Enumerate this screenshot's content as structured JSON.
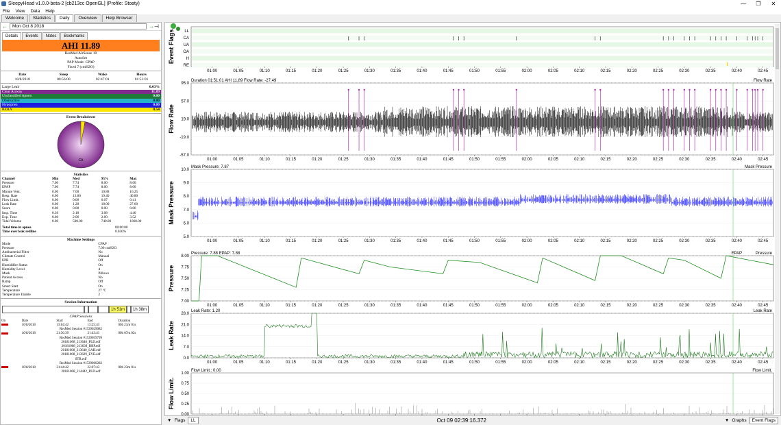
{
  "window": {
    "title": "SleepyHead v1.0.0-beta-2 [cb213cc OpenGL] (Profile: Stoaty)",
    "min": "—",
    "max": "❐",
    "close": "✕"
  },
  "menu": [
    "File",
    "View",
    "Data",
    "Help"
  ],
  "tabs": [
    "Welcome",
    "Statistics",
    "Daily",
    "Overview",
    "Help Browser"
  ],
  "date": "Mon Oct 8 2018",
  "subtabs": [
    "Details",
    "Events",
    "Notes",
    "Bookmarks"
  ],
  "ahi": "AHI 11.89",
  "device": {
    "model": "ResMed AirSense 10",
    "variant": "AutoSet",
    "mode": "PAP Mode: CPAP",
    "fixed": "Fixed 7 (cmH2O)"
  },
  "sleep": {
    "headers": [
      "Date",
      "Sleep",
      "Wake",
      "Hours"
    ],
    "values": [
      "10/8/2018",
      "00:56:00",
      "02:47:01",
      "01:51:01"
    ]
  },
  "events": [
    {
      "name": "Large Leak",
      "value": "0.03%",
      "color": "#ffffff",
      "fg": "#000"
    },
    {
      "name": "Clear Airway",
      "value": "11.89",
      "color": "#7f2a8c",
      "fg": "#fff"
    },
    {
      "name": "Unclassified Apnea",
      "value": "0.00",
      "color": "#1f7a3a",
      "fg": "#fff"
    },
    {
      "name": "Obstructive",
      "value": "0.00",
      "color": "#27b6c8",
      "fg": "#000"
    },
    {
      "name": "Hypopnea",
      "value": "0.00",
      "color": "#1a1ae0",
      "fg": "#fff"
    },
    {
      "name": "RERA",
      "value": "0.54",
      "color": "#ffe800",
      "fg": "#000"
    }
  ],
  "breakdown": {
    "title": "Event Breakdown",
    "label": "CA"
  },
  "statistics": {
    "title": "Statistics",
    "headers": [
      "Channel",
      "Min",
      "Med",
      "95%",
      "Max"
    ],
    "rows": [
      [
        "Pressure",
        "7.00",
        "7.74",
        "8.00",
        "8.00"
      ],
      [
        "EPAP",
        "7.00",
        "7.74",
        "8.00",
        "8.00"
      ],
      [
        "Minute Vent.",
        "0.00",
        "7.00",
        "10.88",
        "16.25"
      ],
      [
        "Resp. Rate",
        "0.00",
        "13.80",
        "19.40",
        "40.80"
      ],
      [
        "Flow Limit.",
        "0.00",
        "0.00",
        "0.07",
        "0.41"
      ],
      [
        "Leak Rate",
        "0.00",
        "1.20",
        "18.00",
        "27.60"
      ],
      [
        "Snore",
        "0.00",
        "0.00",
        "0.00",
        "0.06"
      ],
      [
        "Insp. Time",
        "0.36",
        "2.18",
        "3.08",
        "4.40"
      ],
      [
        "Exp. Time",
        "0.06",
        "2.06",
        "2.60",
        "3.52"
      ],
      [
        "Tidal Volume",
        "0.00",
        "500.00",
        "740.00",
        "1060.00"
      ]
    ]
  },
  "apnea": {
    "label1": "Total time in apnea",
    "value1": "00:06:00",
    "label2": "Time over leak redline",
    "value2": "0.030%"
  },
  "machine": {
    "title": "Machine Settings",
    "rows": [
      [
        "Mode",
        "CPAP"
      ],
      [
        "Pressure",
        "7.00 cmH2O"
      ],
      [
        "Antibacterial Filter",
        "No"
      ],
      [
        "Climate Control",
        "Manual"
      ],
      [
        "EPR",
        "Off"
      ],
      [
        "Humidifier Status",
        "On"
      ],
      [
        "Humidity Level",
        "4"
      ],
      [
        "Mask",
        "Pillows"
      ],
      [
        "Patient Access",
        "No"
      ],
      [
        "Ramp",
        "Off"
      ],
      [
        "Smart Start",
        "On"
      ],
      [
        "Temperature",
        "27 ºC"
      ],
      [
        "Temperature Enable",
        "2"
      ]
    ]
  },
  "session_info": {
    "title": "Session Information",
    "seg1": "1h 51m",
    "seg2": "1h 38m"
  },
  "cpap_sessions": {
    "title": "CPAP Sessions",
    "headers": [
      "On",
      "Date",
      "Start",
      "End",
      "Duration"
    ],
    "rows": [
      {
        "type": "row",
        "date": "10/8/2018",
        "start": "13:04:42",
        "end": "13:25:43",
        "dur": "00h 21m 01s"
      },
      {
        "type": "file",
        "text": "ResMed Session #1539029082"
      },
      {
        "type": "row",
        "date": "10/8/2018",
        "start": "21:36:39",
        "end": "21:43:41",
        "dur": "00h 07m 02s"
      },
      {
        "type": "file",
        "text": "ResMed Session #1539059799"
      },
      {
        "type": "file",
        "text": "20181008_213640_PLD.edf"
      },
      {
        "type": "file",
        "text": "20181008_213639_BRP.edf"
      },
      {
        "type": "file",
        "text": "20181008_213640_SAD.edf"
      },
      {
        "type": "file",
        "text": "20181008_213629_EVE.edf"
      },
      {
        "type": "file",
        "text": "STR.edf"
      },
      {
        "type": "file",
        "text": "ResMed Session #1539060282"
      },
      {
        "type": "row",
        "date": "10/8/2018",
        "start": "21:44:42",
        "end": "22:07:43",
        "dur": "00h 23m 01s"
      },
      {
        "type": "file",
        "text": "20181008_214442_PLD.edf"
      }
    ]
  },
  "time_ticks": [
    "01:00",
    "01:05",
    "01:10",
    "01:15",
    "01:20",
    "01:25",
    "01:30",
    "01:35",
    "01:40",
    "01:45",
    "01:50",
    "01:55",
    "02:00",
    "02:05",
    "02:10",
    "02:15",
    "02:20",
    "02:25",
    "02:30",
    "02:35",
    "02:40",
    "02:45"
  ],
  "graphs": [
    {
      "name": "Event Flags",
      "ylabels": [
        "LL",
        "CA",
        "UA",
        "OA",
        "H",
        "RE"
      ]
    },
    {
      "name": "Flow Rate",
      "header": "Duration 01:51:01 AHI 11.89 Flow Rate: -27.49",
      "legend": "Flow Rate",
      "ylabels": [
        "95.0",
        "57.0",
        "19.0",
        "-19.0",
        "-57.0"
      ]
    },
    {
      "name": "Mask Pressure",
      "header": "Mask Pressure: 7.87",
      "legend": "Mask Pressure",
      "ylabels": [
        "10.0",
        "9.0",
        "8.0",
        "7.0",
        "6.0",
        "5.0"
      ]
    },
    {
      "name": "Pressure",
      "header": "Pressure: 7.88 EPAP: 7.88",
      "legend": "EPAP",
      "legend2": "Pressure",
      "ylabels": [
        "8.00",
        "7.75",
        "7.50",
        "7.25",
        "7.00"
      ]
    },
    {
      "name": "Leak Rate",
      "header": "Leak Rate: 1.20",
      "legend": "Leak Rate",
      "ylabels": [
        "28.0",
        "21.0",
        "14.0",
        "7.0",
        "0.0"
      ]
    },
    {
      "name": "Flow Limit.",
      "header": "Flow Limit.: 0.00",
      "legend": "Flow Limit.",
      "ylabels": [
        "1.00",
        "0.75",
        "0.50",
        "0.25",
        "0.00"
      ]
    }
  ],
  "bottom": {
    "flags": "Flags",
    "flag_sel": "LL",
    "time": "Oct 09 02:39:16.372",
    "graphs": "Graphs",
    "graph_sel": "Event Flags"
  }
}
